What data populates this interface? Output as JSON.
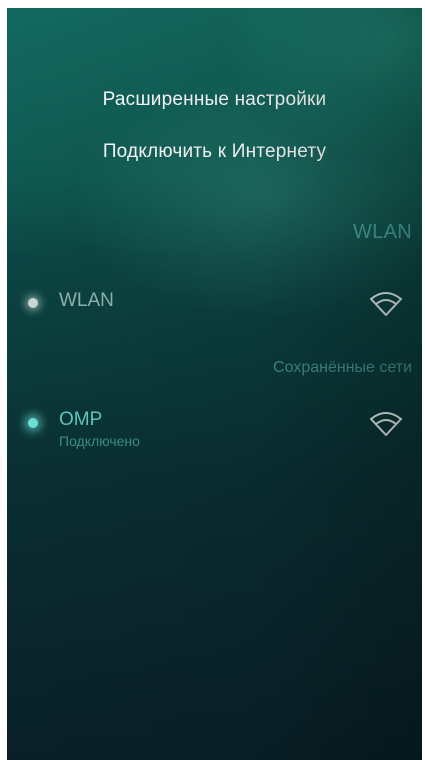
{
  "pulldown_menu": {
    "advanced_settings": "Расширенные настройки",
    "connect_to_internet": "Подключить к Интернету"
  },
  "page_header": {
    "title": "WLAN"
  },
  "wlan_toggle": {
    "label": "WLAN",
    "state": "off",
    "icon": "wifi-icon"
  },
  "saved_networks": {
    "header": "Сохранённые сети",
    "networks": [
      {
        "name": "OMP",
        "status": "Подключено",
        "icon": "wifi-icon"
      }
    ]
  },
  "colors": {
    "accent": "#4fb3ad",
    "highlight": "#6ee0d8",
    "background_top": "#13695f",
    "background_bottom": "#091f27"
  }
}
